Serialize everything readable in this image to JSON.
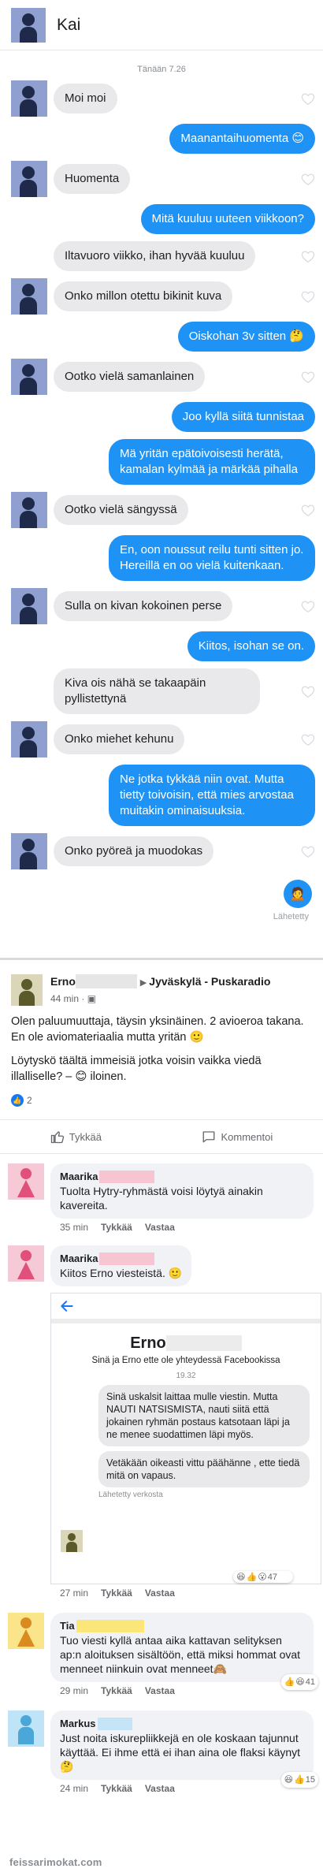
{
  "chat": {
    "contact_name": "Kai",
    "timestamp": "Tänään 7.26",
    "messages": [
      {
        "dir": "in",
        "avatar": true,
        "text": "Moi moi"
      },
      {
        "dir": "out",
        "text": "Maanantaihuomenta 😊"
      },
      {
        "dir": "in",
        "avatar": true,
        "text": "Huomenta"
      },
      {
        "dir": "out",
        "text": "Mitä kuuluu uuteen viikkoon?"
      },
      {
        "dir": "in",
        "avatar": false,
        "text": "Iltavuoro viikko, ihan hyvää kuuluu"
      },
      {
        "dir": "in",
        "avatar": true,
        "text": "Onko millon otettu bikinit kuva"
      },
      {
        "dir": "out",
        "text": "Oiskohan 3v sitten 🤔"
      },
      {
        "dir": "in",
        "avatar": true,
        "text": "Ootko vielä samanlainen"
      },
      {
        "dir": "out",
        "text": "Joo kyllä siitä tunnistaa"
      },
      {
        "dir": "out",
        "text": "Mä yritän epätoivoisesti herätä, kamalan kylmää ja märkää pihalla"
      },
      {
        "dir": "in",
        "avatar": true,
        "text": "Ootko vielä sängyssä"
      },
      {
        "dir": "out",
        "text": "En, oon noussut reilu tunti sitten jo. Hereillä en oo vielä kuitenkaan."
      },
      {
        "dir": "in",
        "avatar": true,
        "text": "Sulla on kivan kokoinen perse"
      },
      {
        "dir": "out",
        "text": "Kiitos, isohan se on."
      },
      {
        "dir": "in",
        "avatar": false,
        "text": "Kiva ois nähä se takaapäin pyllistettynä"
      },
      {
        "dir": "in",
        "avatar": true,
        "text": "Onko miehet kehunu"
      },
      {
        "dir": "out",
        "text": "Ne jotka tykkää niin ovat. Mutta tietty toivoisin, että mies arvostaa muitakin ominaisuuksia."
      },
      {
        "dir": "in",
        "avatar": true,
        "text": "Onko pyöreä ja muodokas"
      }
    ],
    "sent_emoji": "🙍",
    "sent_label": "Lähetetty"
  },
  "post": {
    "author": "Erno",
    "group": "Jyväskylä - Puskaradio",
    "time": "44 min · ",
    "paragraph1": "Olen paluumuuttaja, täysin yksinäinen. 2 avioeroa takana.  En ole aviomateriaalia mutta yritän 🙂",
    "paragraph2": "Löytyskö täältä immeisiä jotka voisin vaikka viedä illalliselle? – 😊 iloinen.",
    "like_count": "2",
    "like_label": "Tykkää",
    "comment_label": "Kommentoi"
  },
  "comments": [
    {
      "author": "Maarika",
      "text": "Tuolta Hytry-ryhmästä voisi löytyä ainakin kavereita.",
      "time": "35 min",
      "like": "Tykkää",
      "reply": "Vastaa"
    },
    {
      "author": "Maarika",
      "text": "Kiitos Erno viesteistä. 🙂",
      "time": "27 min",
      "like": "Tykkää",
      "reply": "Vastaa",
      "reaction_count": "47"
    },
    {
      "author": "Tia",
      "text": "Tuo viesti kyllä antaa aika kattavan selityksen ap:n aloituksen sisältöön, että miksi hommat ovat menneet niinkuin ovat menneet🙈",
      "time": "29 min",
      "like": "Tykkää",
      "reply": "Vastaa",
      "reaction_count": "41"
    },
    {
      "author": "Markus",
      "text": "Just noita iskurepliikkejä en ole koskaan tajunnut käyttää. Ei ihme että ei ihan aina ole flaksi käynyt 🤔",
      "time": "24 min",
      "like": "Tykkää",
      "reply": "Vastaa",
      "reaction_count": "15"
    }
  ],
  "embed": {
    "name": "Erno",
    "subtitle": "Sinä ja Erno ette ole yhteydessä Facebookissa",
    "time": "19.32",
    "message1": "Sinä uskalsit laittaa mulle viestin. Mutta NAUTI NATSISMISTA, nauti siitä että jokainen ryhmän postaus katsotaan läpi ja ne menee suodattimen läpi myös.",
    "message2": "Vetäkään oikeasti vittu päähänne , ette tiedä mitä on vapaus.",
    "sent_label": "Lähetetty verkosta"
  },
  "watermark": "feissarimokat.com",
  "colors": {
    "messenger_blue": "#1f93f5",
    "incoming_bubble": "#e9e9eb",
    "facebook_blue": "#1877f2"
  }
}
